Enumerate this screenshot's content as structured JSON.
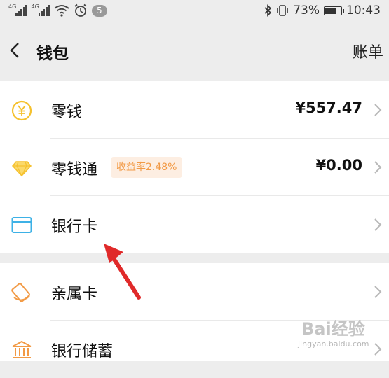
{
  "status_bar": {
    "network_1": "4G",
    "network_2": "4G",
    "notification_count": "5",
    "battery_percent": "73%",
    "battery_level": 0.73,
    "time": "10:43",
    "icons": [
      "signal-icon",
      "signal-icon",
      "wifi-icon",
      "alarm-icon",
      "bluetooth-icon",
      "vibrate-icon",
      "battery-icon"
    ]
  },
  "nav": {
    "title": "钱包",
    "action": "账单"
  },
  "items": [
    {
      "label": "零钱",
      "value": "¥557.47",
      "icon": "coin-icon"
    },
    {
      "label": "零钱通",
      "badge": "收益率2.48%",
      "value": "¥0.00",
      "icon": "diamond-icon"
    },
    {
      "label": "银行卡",
      "value": "",
      "icon": "card-icon"
    },
    {
      "label": "亲属卡",
      "value": "",
      "icon": "family-card-icon"
    },
    {
      "label": "银行储蓄",
      "value": "",
      "icon": "bank-icon"
    }
  ],
  "colors": {
    "accent_yellow": "#f5c12e",
    "accent_orange": "#f29a45",
    "card_blue": "#3db1e6",
    "arrow_red": "#e02a2a"
  },
  "watermark": {
    "text": "Bai经验",
    "sub": "jingyan.baidu.com"
  }
}
